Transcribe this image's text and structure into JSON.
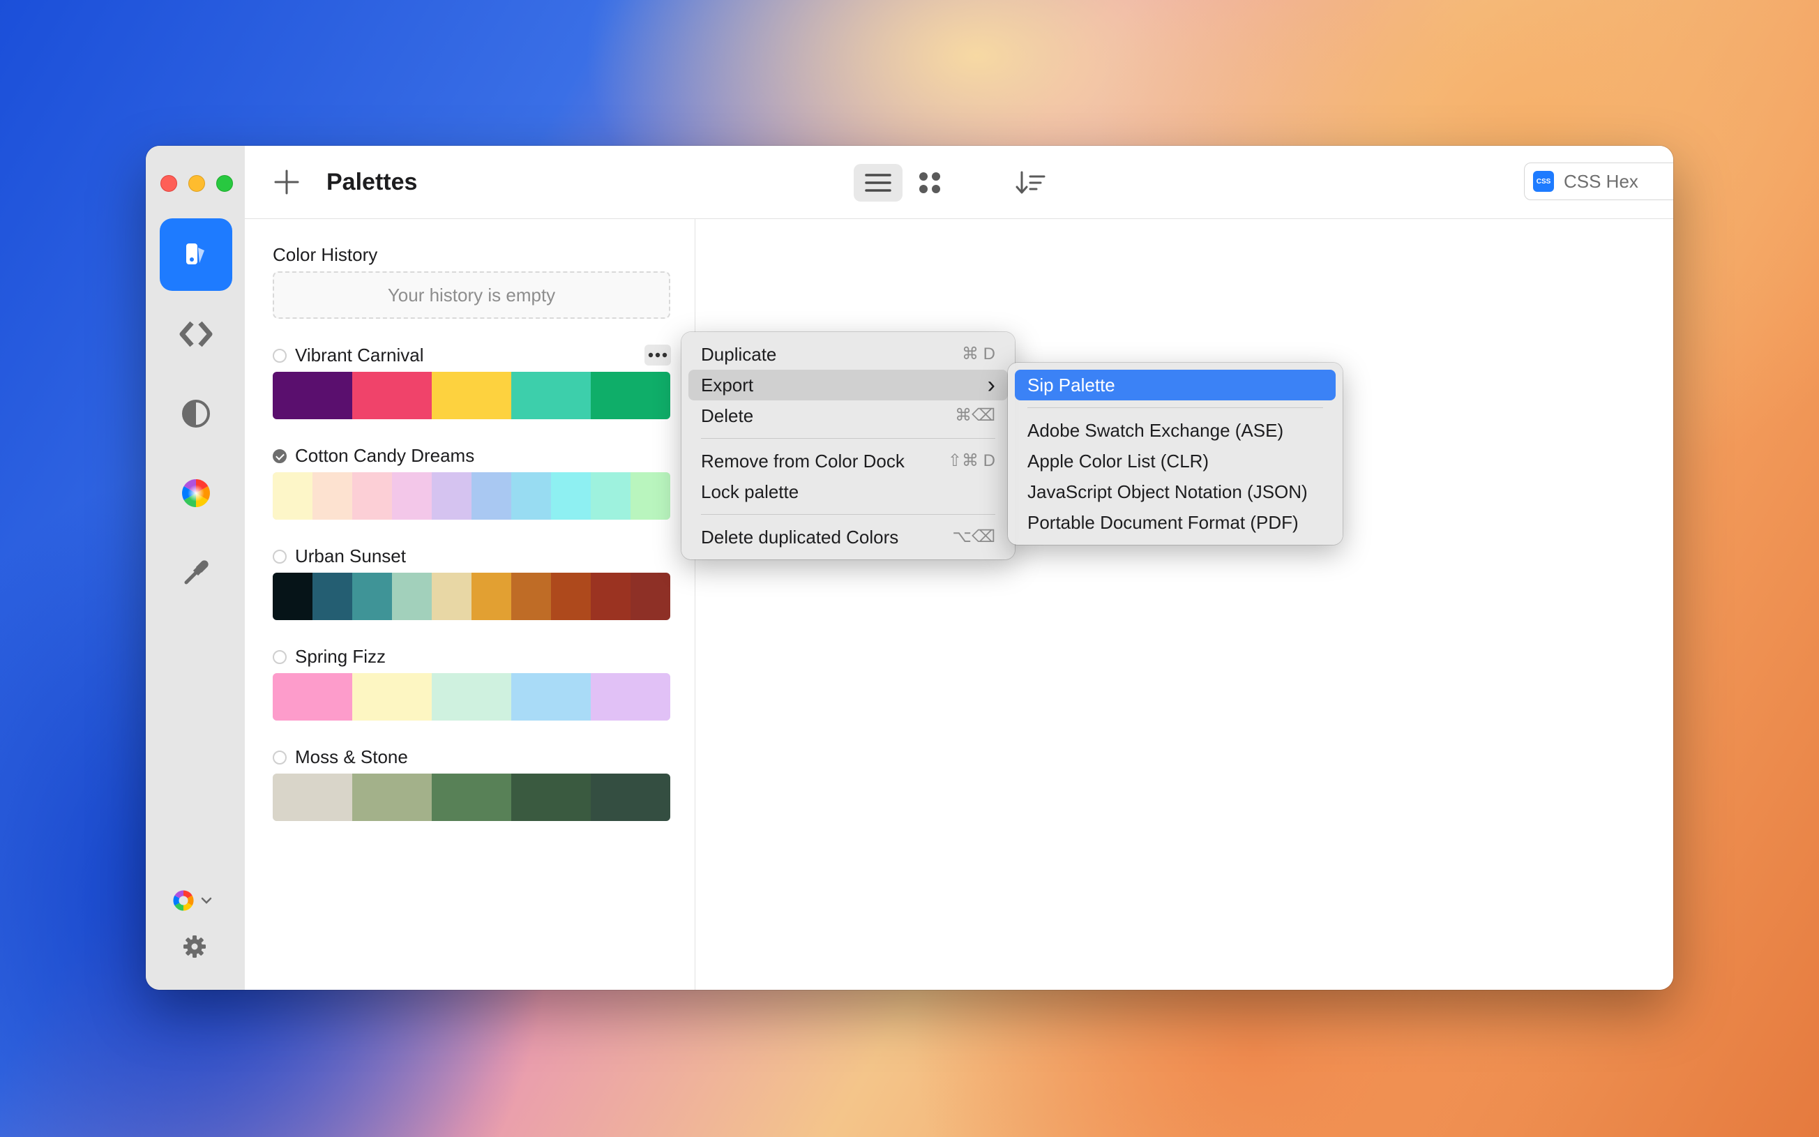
{
  "app": {
    "title": "Palettes",
    "format_select": {
      "badge": "CSS",
      "value": "CSS Hex"
    }
  },
  "history": {
    "label": "Color History",
    "empty_text": "Your history is empty"
  },
  "palettes": [
    {
      "name": "Vibrant Carnival",
      "checked": false,
      "colors": [
        "#5a0f6e",
        "#f0436a",
        "#fdd23f",
        "#3dcfab",
        "#0fae69"
      ]
    },
    {
      "name": "Cotton Candy Dreams",
      "checked": true,
      "colors": [
        "#fdf6c8",
        "#fde2d0",
        "#fccfd6",
        "#f3c7e9",
        "#d5c3f0",
        "#a9c8f2",
        "#98dcf2",
        "#8ef0f2",
        "#9ef2de",
        "#b9f5be"
      ]
    },
    {
      "name": "Urban Sunset",
      "checked": false,
      "colors": [
        "#061418",
        "#245e72",
        "#3f9497",
        "#a2d0bb",
        "#e8d7a5",
        "#e2a032",
        "#bf6c26",
        "#ae491c",
        "#9b3321",
        "#8e3026"
      ]
    },
    {
      "name": "Spring Fizz",
      "checked": false,
      "colors": [
        "#fd9ccb",
        "#fdf6c2",
        "#cff1df",
        "#a9dbf7",
        "#e1c1f6"
      ]
    },
    {
      "name": "Moss & Stone",
      "checked": false,
      "colors": [
        "#d9d5c9",
        "#a3b18a",
        "#588157",
        "#3a5a40",
        "#344e41"
      ]
    }
  ],
  "context_menu": {
    "items": [
      {
        "label": "Duplicate",
        "shortcut": "⌘ D"
      },
      {
        "label": "Export",
        "shortcut": "›"
      },
      {
        "label": "Delete",
        "shortcut": "⌘⌫"
      },
      {
        "label": "Remove from Color Dock",
        "shortcut": "⇧⌘ D"
      },
      {
        "label": "Lock palette",
        "shortcut": ""
      },
      {
        "label": "Delete duplicated Colors",
        "shortcut": "⌥⌫"
      }
    ]
  },
  "export_menu": {
    "items": [
      {
        "label": "Sip Palette"
      },
      {
        "label": "Adobe Swatch Exchange (ASE)"
      },
      {
        "label": "Apple Color List (CLR)"
      },
      {
        "label": "JavaScript Object Notation (JSON)"
      },
      {
        "label": "Portable Document Format (PDF)"
      }
    ]
  },
  "icons": {
    "sidebar": [
      "palettes-icon",
      "code-brackets-icon",
      "contrast-icon",
      "color-wheel-icon",
      "eyedropper-icon"
    ],
    "bottom": [
      "color-wheel-menu-icon",
      "gear-icon"
    ]
  },
  "colors": {
    "accent": "#1e7bff",
    "selection": "#3b82f6"
  }
}
